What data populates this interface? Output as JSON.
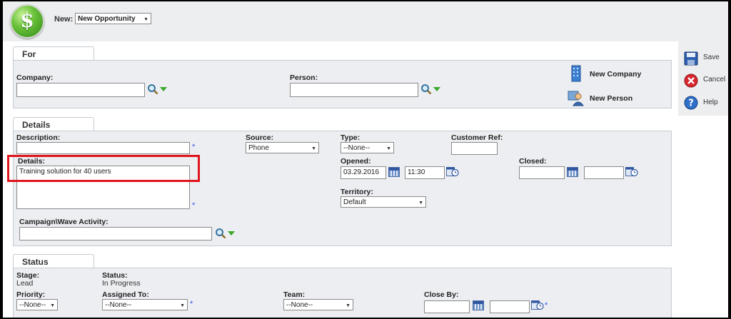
{
  "header": {
    "new_label": "New:",
    "new_select": "New Opportunity"
  },
  "for_section": {
    "tab": "For",
    "company_label": "Company:",
    "company_value": "",
    "person_label": "Person:",
    "person_value": "",
    "new_company": "New Company",
    "new_person": "New Person"
  },
  "details_section": {
    "tab": "Details",
    "description_label": "Description:",
    "description_value": "",
    "details_label": "Details:",
    "details_value": "Training solution for 40 users",
    "source_label": "Source:",
    "source_value": "Phone",
    "type_label": "Type:",
    "type_value": "--None--",
    "customer_ref_label": "Customer Ref:",
    "customer_ref_value": "",
    "opened_label": "Opened:",
    "opened_date": "03.29.2016",
    "opened_time": "11:30",
    "closed_label": "Closed:",
    "closed_date": "",
    "closed_time": "",
    "territory_label": "Territory:",
    "territory_value": "Default",
    "campaign_label": "Campaign\\Wave Activity:",
    "campaign_value": ""
  },
  "status_section": {
    "tab": "Status",
    "stage_label": "Stage:",
    "stage_value": "Lead",
    "status_label": "Status:",
    "status_value": "In Progress",
    "priority_label": "Priority:",
    "priority_value": "--None--",
    "assigned_label": "Assigned To:",
    "assigned_value": "--None--",
    "team_label": "Team:",
    "team_value": "--None--",
    "closeby_label": "Close By:",
    "closeby_date": "",
    "closeby_time": ""
  },
  "actions": {
    "save": "Save",
    "cancel": "Cancel",
    "help": "Help"
  },
  "colors": {
    "highlight": "#e0151c",
    "required": "#3355ee",
    "accent_green": "#3aa829"
  },
  "icons": [
    "dollar-logo-icon",
    "magnifier-icon",
    "dropdown-arrow-icon",
    "calendar-icon",
    "clock-icon",
    "building-icon",
    "person-icon",
    "save-icon",
    "cancel-icon",
    "help-icon"
  ]
}
